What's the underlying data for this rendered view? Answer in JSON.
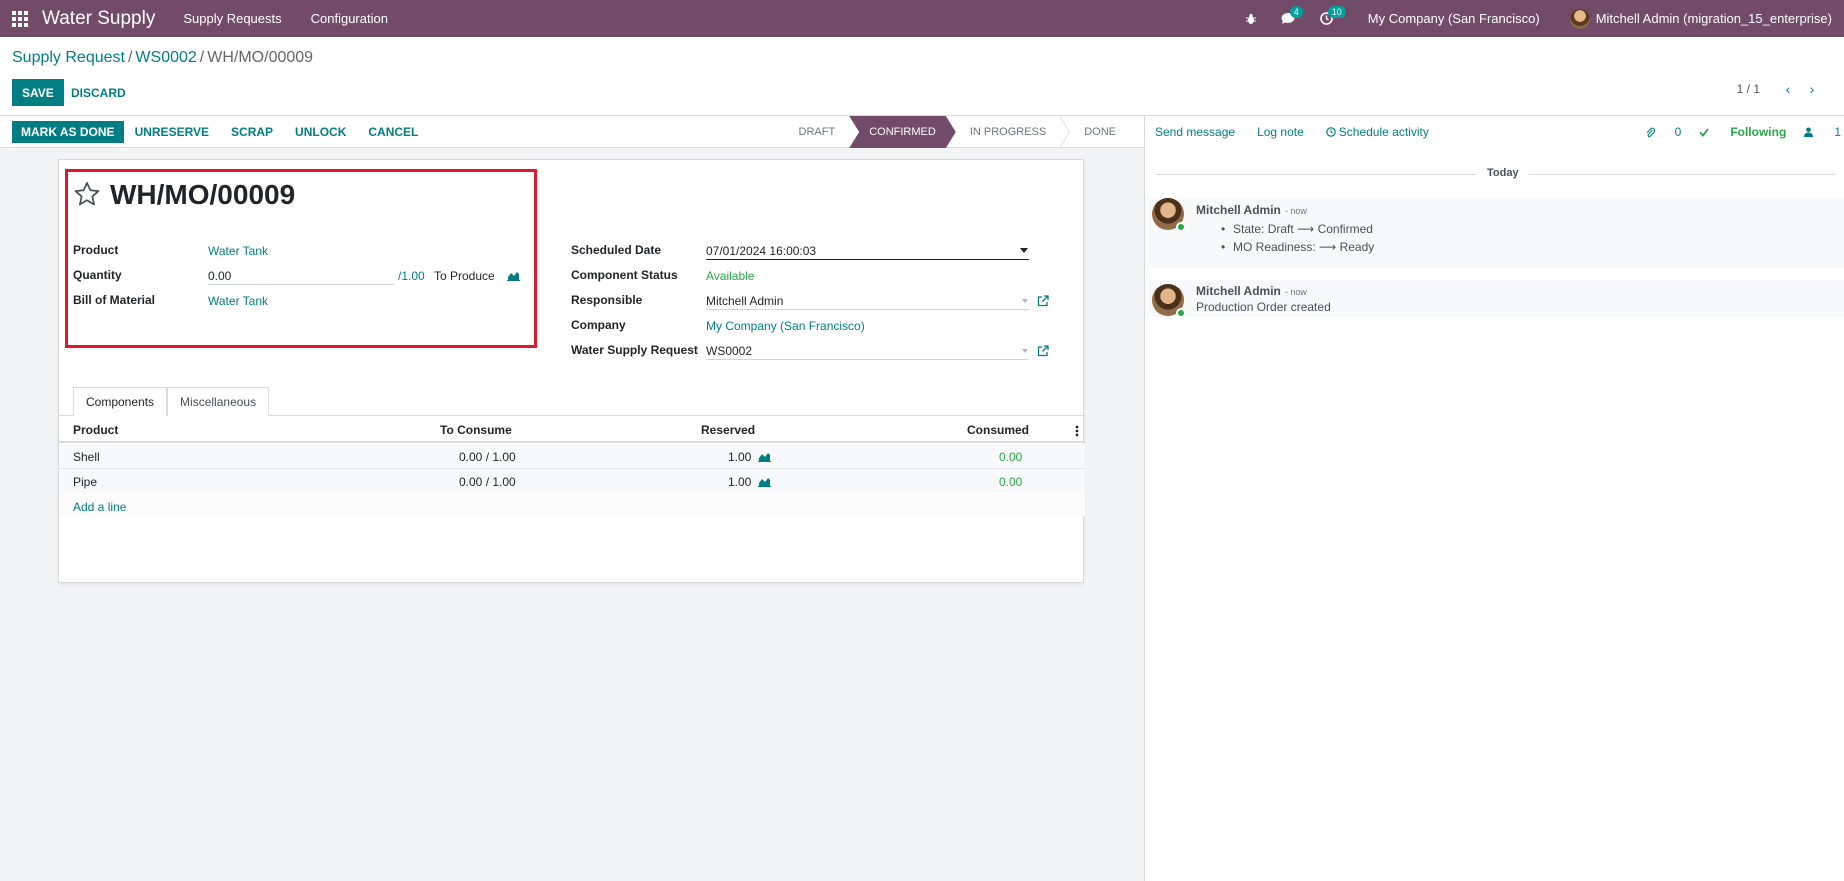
{
  "navbar": {
    "app_name": "Water Supply",
    "menus": [
      "Supply Requests",
      "Configuration"
    ],
    "messages_count": "4",
    "activities_count": "10",
    "company": "My Company (San Francisco)",
    "user": "Mitchell Admin (migration_15_enterprise)",
    "accent_color": "#714b67"
  },
  "breadcrumb": {
    "items": [
      "Supply Request",
      "WS0002"
    ],
    "current": "WH/MO/00009"
  },
  "toolbar": {
    "save_label": "SAVE",
    "discard_label": "DISCARD"
  },
  "pager": {
    "value": "1 / 1"
  },
  "statusbar": {
    "buttons": [
      "MARK AS DONE",
      "UNRESERVE",
      "SCRAP",
      "UNLOCK",
      "CANCEL"
    ],
    "stages": [
      "DRAFT",
      "CONFIRMED",
      "IN PROGRESS",
      "DONE"
    ],
    "active_stage": "CONFIRMED"
  },
  "form": {
    "title": "WH/MO/00009",
    "product_label": "Product",
    "product_value": "Water Tank",
    "quantity_label": "Quantity",
    "quantity_value": "0.00",
    "quantity_target": "/1.00",
    "to_produce": "To Produce",
    "bom_label": "Bill of Material",
    "bom_value": "Water Tank",
    "scheduled_date_label": "Scheduled Date",
    "scheduled_date_value": "07/01/2024 16:00:03",
    "component_status_label": "Component Status",
    "component_status_value": "Available",
    "responsible_label": "Responsible",
    "responsible_value": "Mitchell Admin",
    "company_label": "Company",
    "company_value": "My Company (San Francisco)",
    "wsr_label": "Water Supply Request",
    "wsr_value": "WS0002"
  },
  "tabs": [
    "Components",
    "Miscellaneous"
  ],
  "table": {
    "headers": [
      "Product",
      "To Consume",
      "Reserved",
      "Consumed"
    ],
    "rows": [
      {
        "product": "Shell",
        "to_consume": "0.00 / 1.00",
        "reserved": "1.00",
        "consumed": "0.00"
      },
      {
        "product": "Pipe",
        "to_consume": "0.00 / 1.00",
        "reserved": "1.00",
        "consumed": "0.00"
      }
    ],
    "add_line": "Add a line"
  },
  "chatter": {
    "send_message": "Send message",
    "log_note": "Log note",
    "schedule_activity": "Schedule activity",
    "attachments": "0",
    "following": "Following",
    "followers": "1",
    "today": "Today",
    "messages": [
      {
        "author": "Mitchell Admin",
        "when": "- now",
        "tracking": [
          "State: Draft ⟶ Confirmed",
          "MO Readiness: ⟶ Ready"
        ]
      },
      {
        "author": "Mitchell Admin",
        "when": "- now",
        "body": "Production Order created"
      }
    ]
  }
}
